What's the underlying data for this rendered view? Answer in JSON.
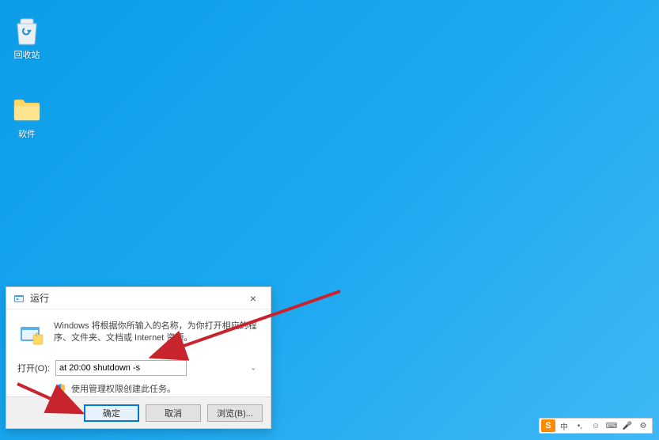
{
  "desktop": {
    "recycle_bin_label": "回收站",
    "folder_label": "软件"
  },
  "run_dialog": {
    "title": "运行",
    "description": "Windows 将根据你所输入的名称，为你打开相应的程序、文件夹、文档或 Internet 资源。",
    "open_label": "打开(O):",
    "input_value": "at 20:00 shutdown -s",
    "admin_note": "使用管理权限创建此任务。",
    "ok_button": "确定",
    "cancel_button": "取消",
    "browse_button": "浏览(B)..."
  },
  "ime": {
    "lang": "中"
  },
  "colors": {
    "desktop_bg": "#1ba8f0",
    "accent": "#0078d7",
    "annotation": "#c8242e"
  }
}
